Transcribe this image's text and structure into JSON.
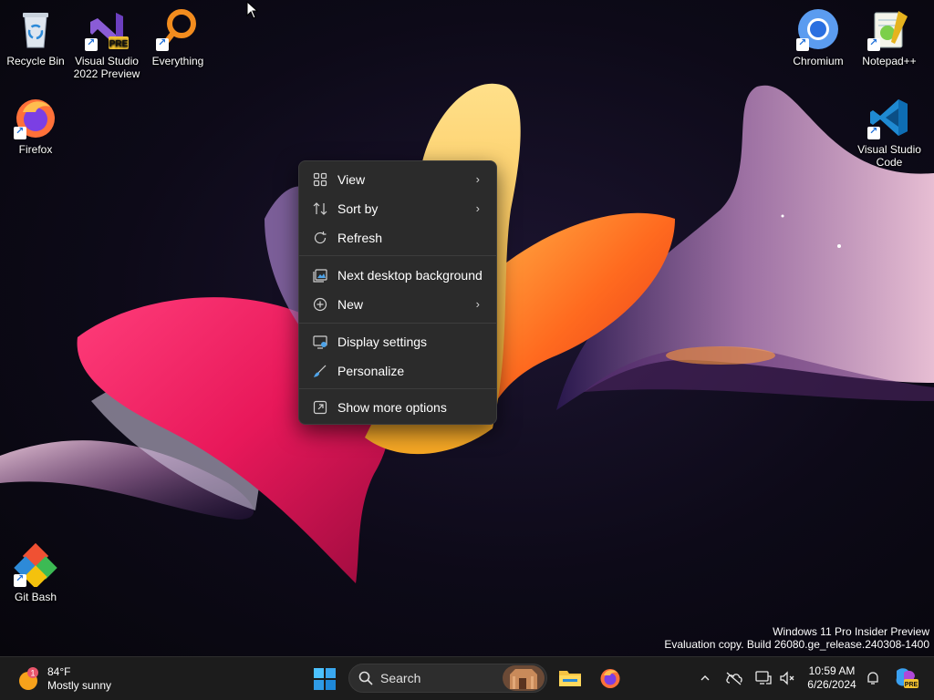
{
  "desktop_icons": [
    {
      "label": "Recycle Bin",
      "icon": "recycle-bin-icon"
    },
    {
      "label": "Visual Studio 2022 Preview",
      "icon": "visual-studio-icon",
      "badge": "PRE"
    },
    {
      "label": "Everything",
      "icon": "everything-search-icon"
    },
    {
      "label": "Firefox",
      "icon": "firefox-icon"
    },
    {
      "label": "Git Bash",
      "icon": "git-bash-icon"
    },
    {
      "label": "Chromium",
      "icon": "chromium-icon"
    },
    {
      "label": "Notepad++",
      "icon": "notepad-plus-plus-icon"
    },
    {
      "label": "Visual Studio Code",
      "icon": "vscode-icon"
    }
  ],
  "context_menu": {
    "items": [
      {
        "label": "View",
        "icon": "view-grid-icon",
        "submenu": true
      },
      {
        "label": "Sort by",
        "icon": "sort-icon",
        "submenu": true
      },
      {
        "label": "Refresh",
        "icon": "refresh-icon",
        "submenu": false
      },
      {
        "label": "Next desktop background",
        "icon": "next-background-icon",
        "submenu": false
      },
      {
        "label": "New",
        "icon": "new-plus-icon",
        "submenu": true
      },
      {
        "label": "Display settings",
        "icon": "display-settings-icon",
        "submenu": false
      },
      {
        "label": "Personalize",
        "icon": "personalize-brush-icon",
        "submenu": false
      },
      {
        "label": "Show more options",
        "icon": "show-more-options-icon",
        "submenu": false
      }
    ],
    "chevron": "›"
  },
  "watermark": {
    "line1": "Windows 11 Pro Insider Preview",
    "line2": "Evaluation copy. Build 26080.ge_release.240308-1400"
  },
  "taskbar": {
    "weather": {
      "temp": "84°F",
      "condition": "Mostly sunny",
      "badge": "1"
    },
    "search": {
      "label": "Search"
    },
    "clock": {
      "time": "10:59 AM",
      "date": "6/26/2024"
    },
    "tray_icons": [
      "chevron-up-icon",
      "onedrive-offline-icon",
      "network-icon",
      "volume-muted-icon",
      "notification-bell-icon",
      "copilot-icon"
    ],
    "pinned": [
      "file-explorer-icon",
      "firefox-icon"
    ],
    "copilot_badge": "PRE",
    "accent": "#0078d4"
  }
}
